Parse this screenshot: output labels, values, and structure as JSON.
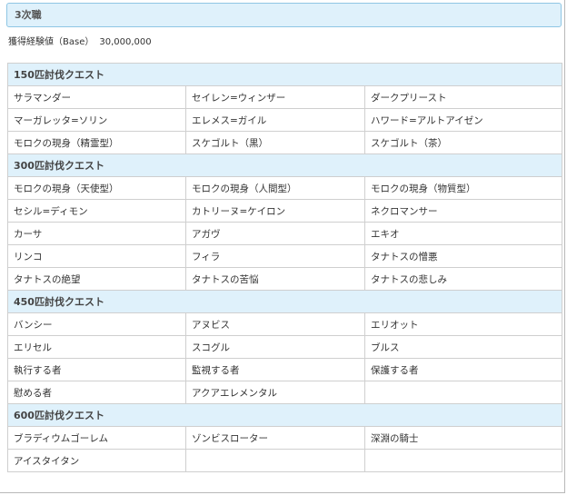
{
  "section_title": "3次職",
  "exp": {
    "label": "獲得経験値（Base）",
    "value": "30,000,000"
  },
  "groups": [
    {
      "title": "150匹討伐クエスト",
      "rows": [
        [
          "サラマンダー",
          "セイレン=ウィンザー",
          "ダークプリースト"
        ],
        [
          "マーガレッタ=ソリン",
          "エレメス=ガイル",
          "ハワード=アルトアイゼン"
        ],
        [
          "モロクの現身（精霊型）",
          "スケゴルト（黒）",
          "スケゴルト（茶）"
        ]
      ]
    },
    {
      "title": "300匹討伐クエスト",
      "rows": [
        [
          "モロクの現身（天使型）",
          "モロクの現身（人間型）",
          "モロクの現身（物質型）"
        ],
        [
          "セシル=ディモン",
          "カトリーヌ=ケイロン",
          "ネクロマンサー"
        ],
        [
          "カーサ",
          "アガヴ",
          "エキオ"
        ],
        [
          "リンコ",
          "フィラ",
          "タナトスの憎悪"
        ],
        [
          "タナトスの絶望",
          "タナトスの苦悩",
          "タナトスの悲しみ"
        ]
      ]
    },
    {
      "title": "450匹討伐クエスト",
      "rows": [
        [
          "バンシー",
          "アヌビス",
          "エリオット"
        ],
        [
          "エリセル",
          "スコグル",
          "ブルス"
        ],
        [
          "執行する者",
          "監視する者",
          "保護する者"
        ],
        [
          "慰める者",
          "アクアエレメンタル",
          ""
        ]
      ]
    },
    {
      "title": "600匹討伐クエスト",
      "rows": [
        [
          "ブラディウムゴーレム",
          "ゾンビスローター",
          "深淵の騎士"
        ],
        [
          "アイスタイタン",
          "",
          ""
        ]
      ]
    }
  ]
}
